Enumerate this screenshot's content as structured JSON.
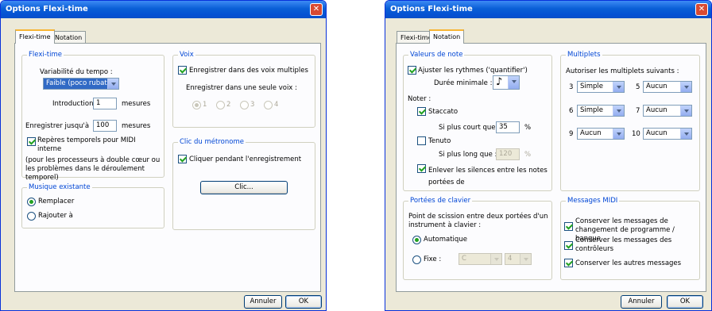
{
  "left": {
    "title": "Options Flexi-time",
    "tabs": [
      "Flexi-time",
      "Notation"
    ],
    "flexi": {
      "group": "Flexi-time",
      "variability_label": "Variabilité du tempo :",
      "variability_value": "Faible (poco rubato)",
      "intro_label": "Introduction",
      "intro_value": "1",
      "intro_unit": "mesures",
      "record_label": "Enregistrer jusqu'à",
      "record_value": "100",
      "record_unit": "mesures",
      "midi_label": "Repères temporels pour MIDI interne",
      "note": "(pour les processeurs à double cœur ou les problèmes dans le déroulement temporel)"
    },
    "voix": {
      "group": "Voix",
      "multi_label": "Enregistrer dans des voix multiples",
      "single_label": "Enregistrer dans une seule voix :",
      "options": [
        "1",
        "2",
        "3",
        "4"
      ]
    },
    "metro": {
      "group": "Clic du métronome",
      "click_label": "Cliquer pendant l'enregistrement",
      "button": "Clic..."
    },
    "music": {
      "group": "Musique existante",
      "replace": "Remplacer",
      "append": "Rajouter à"
    },
    "cancel": "Annuler",
    "ok": "OK"
  },
  "right": {
    "title": "Options Flexi-time",
    "tabs": [
      "Flexi-time",
      "Notation"
    ],
    "notes": {
      "group": "Valeurs de note",
      "adjust_label": "Ajuster les rythmes ('quantifier')",
      "min_label": "Durée minimale :",
      "min_glyph": "♪",
      "noter": "Noter :",
      "staccato": "Staccato",
      "shorter_label": "Si plus court que :",
      "shorter_value": "35",
      "percent": "%",
      "tenuto": "Tenuto",
      "longer_label": "Si plus long que :",
      "longer_value": "120",
      "rests_label": "Enlever les silences entre les notes portées de"
    },
    "tuplets": {
      "group": "Multiplets",
      "label": "Autoriser les multiplets suivants :",
      "items": [
        {
          "n": "3",
          "v": "Simple"
        },
        {
          "n": "5",
          "v": "Aucun"
        },
        {
          "n": "6",
          "v": "Simple"
        },
        {
          "n": "7",
          "v": "Aucun"
        },
        {
          "n": "9",
          "v": "Aucun"
        },
        {
          "n": "10",
          "v": "Aucun"
        }
      ]
    },
    "keyboard": {
      "group": "Portées de clavier",
      "label": "Point de scission entre deux portées d'un instrument à clavier :",
      "auto": "Automatique",
      "fixed": "Fixe :",
      "note": "C",
      "octave": "4"
    },
    "midi": {
      "group": "Messages MIDI",
      "items": [
        "Conserver les messages de changement de programme / banque",
        "Conserver les messages des contrôleurs",
        "Conserver les autres messages"
      ]
    },
    "cancel": "Annuler",
    "ok": "OK"
  }
}
